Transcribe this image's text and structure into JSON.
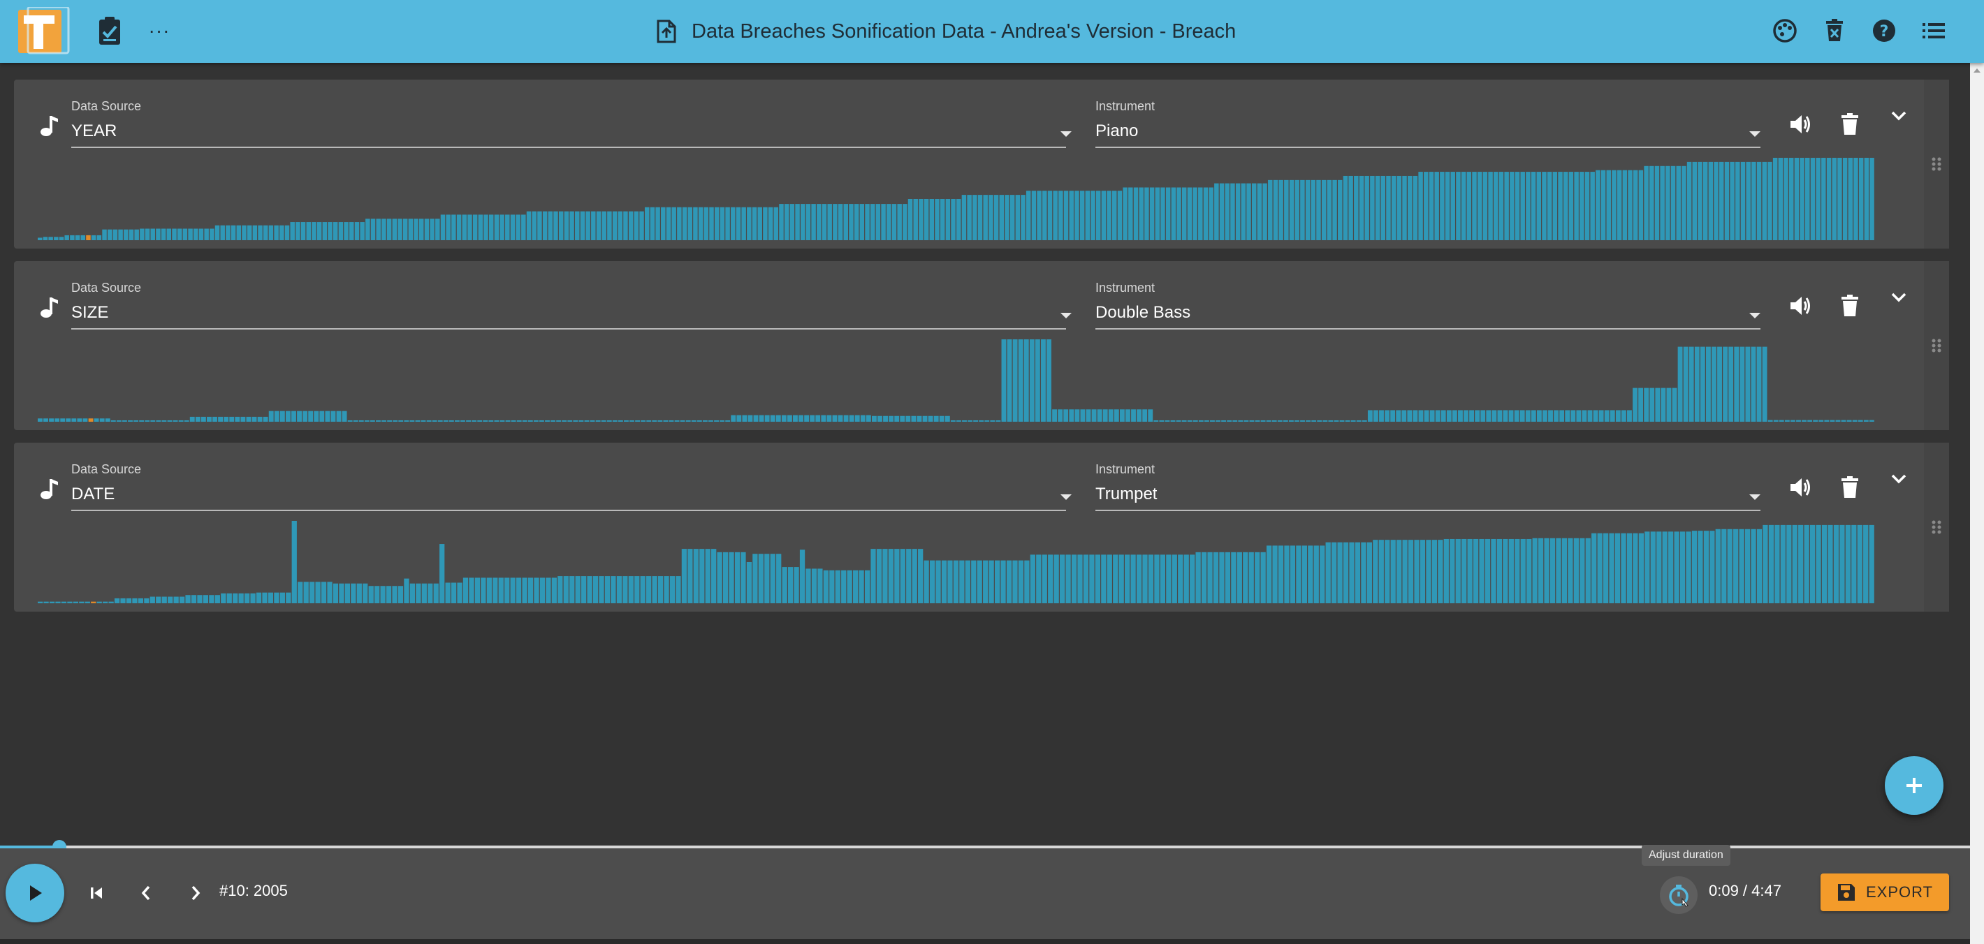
{
  "header": {
    "title": "Data Breaches Sonification Data - Andrea's Version - Breach",
    "more_label": "···",
    "colors": {
      "bar": "#55b9de",
      "title_text": "#1f2d36"
    },
    "icons": [
      "app-logo",
      "edit-document-icon",
      "more-icon",
      "upload-file-icon",
      "palette-icon",
      "delete-dataset-icon",
      "help-icon",
      "list-icon"
    ]
  },
  "tracks": [
    {
      "data_source_label": "Data Source",
      "data_source_value": "YEAR",
      "instrument_label": "Instrument",
      "instrument_value": "Piano"
    },
    {
      "data_source_label": "Data Source",
      "data_source_value": "SIZE",
      "instrument_label": "Instrument",
      "instrument_value": "Double Bass"
    },
    {
      "data_source_label": "Data Source",
      "data_source_value": "DATE",
      "instrument_label": "Instrument",
      "instrument_value": "Trumpet"
    }
  ],
  "chart_data": [
    {
      "type": "bar",
      "series_name": "YEAR",
      "highlight_index": 9,
      "segments": [
        [
          1,
          0.03
        ],
        [
          4,
          0.04
        ],
        [
          7,
          0.06
        ],
        [
          7,
          0.13
        ],
        [
          14,
          0.14
        ],
        [
          14,
          0.18
        ],
        [
          14,
          0.22
        ],
        [
          14,
          0.26
        ],
        [
          16,
          0.31
        ],
        [
          22,
          0.35
        ],
        [
          25,
          0.4
        ],
        [
          24,
          0.44
        ],
        [
          10,
          0.5
        ],
        [
          12,
          0.55
        ],
        [
          18,
          0.6
        ],
        [
          17,
          0.64
        ],
        [
          10,
          0.69
        ],
        [
          14,
          0.73
        ],
        [
          14,
          0.78
        ],
        [
          33,
          0.83
        ],
        [
          9,
          0.85
        ],
        [
          8,
          0.9
        ],
        [
          16,
          0.95
        ],
        [
          19,
          1.0
        ]
      ],
      "colors": {
        "bar": "#2f98b7",
        "highlight": "#e08a2a"
      }
    },
    {
      "type": "bar",
      "series_name": "SIZE",
      "highlight_index": 9,
      "segments": [
        [
          13,
          0.04
        ],
        [
          14,
          0.01
        ],
        [
          14,
          0.06
        ],
        [
          14,
          0.13
        ],
        [
          30,
          0.01
        ],
        [
          38,
          0.01
        ],
        [
          25,
          0.08
        ],
        [
          14,
          0.07
        ],
        [
          9,
          0.01
        ],
        [
          9,
          1.0
        ],
        [
          18,
          0.15
        ],
        [
          28,
          0.01
        ],
        [
          10,
          0.01
        ],
        [
          47,
          0.14
        ],
        [
          8,
          0.41
        ],
        [
          16,
          0.91
        ],
        [
          19,
          0.02
        ]
      ],
      "colors": {
        "bar": "#2f98b7",
        "highlight": "#e08a2a"
      }
    },
    {
      "type": "bar",
      "series_name": "DATE",
      "highlight_index": 9,
      "segments": [
        [
          13,
          0.02
        ],
        [
          6,
          0.06
        ],
        [
          6,
          0.08
        ],
        [
          6,
          0.1
        ],
        [
          6,
          0.12
        ],
        [
          6,
          0.13
        ],
        [
          1,
          1.0
        ],
        [
          6,
          0.26
        ],
        [
          6,
          0.24
        ],
        [
          6,
          0.21
        ],
        [
          1,
          0.3
        ],
        [
          5,
          0.24
        ],
        [
          1,
          0.72
        ],
        [
          3,
          0.25
        ],
        [
          16,
          0.31
        ],
        [
          21,
          0.33
        ],
        [
          6,
          0.66
        ],
        [
          5,
          0.62
        ],
        [
          1,
          0.5
        ],
        [
          5,
          0.6
        ],
        [
          3,
          0.44
        ],
        [
          1,
          0.65
        ],
        [
          3,
          0.42
        ],
        [
          8,
          0.4
        ],
        [
          9,
          0.66
        ],
        [
          18,
          0.52
        ],
        [
          28,
          0.59
        ],
        [
          12,
          0.62
        ],
        [
          10,
          0.7
        ],
        [
          8,
          0.74
        ],
        [
          12,
          0.77
        ],
        [
          15,
          0.78
        ],
        [
          10,
          0.79
        ],
        [
          9,
          0.85
        ],
        [
          8,
          0.87
        ],
        [
          4,
          0.88
        ],
        [
          8,
          0.9
        ],
        [
          19,
          0.95
        ]
      ],
      "colors": {
        "bar": "#2f98b7",
        "highlight": "#e08a2a"
      }
    }
  ],
  "player": {
    "row_info": "#10: 2005",
    "time": "0:09 / 4:47",
    "progress": 0.03,
    "tooltip": "Adjust duration",
    "export_label": "EXPORT",
    "colors": {
      "accent": "#55b9de",
      "export": "#f39b2a"
    }
  },
  "fab": {
    "icon": "plus-icon"
  }
}
